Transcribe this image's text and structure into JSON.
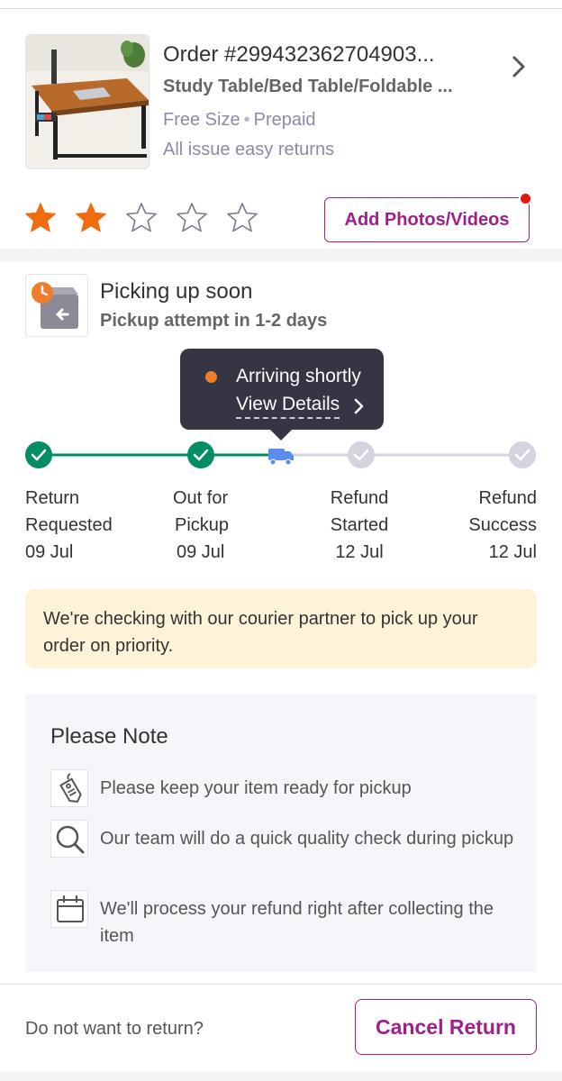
{
  "order": {
    "title": "Order #299432362704903...",
    "product_name": "Study Table/Bed Table/Foldable ...",
    "size": "Free Size",
    "payment": "Prepaid",
    "returns_note": "All issue easy returns",
    "rating": {
      "value": 2,
      "max": 5
    },
    "add_photos_label": "Add Photos/Videos"
  },
  "status": {
    "title": "Picking up soon",
    "subtitle": "Pickup attempt in 1-2 days",
    "tooltip_text": "Arriving shortly",
    "tooltip_link": "View Details",
    "steps": [
      {
        "line1": "Return",
        "line2": "Requested",
        "date": "09 Jul",
        "state": "done"
      },
      {
        "line1": "Out for",
        "line2": "Pickup",
        "date": "09 Jul",
        "state": "done"
      },
      {
        "line1": "Refund",
        "line2": "Started",
        "date": "12 Jul",
        "state": "pending"
      },
      {
        "line1": "Refund",
        "line2": "Success",
        "date": "12 Jul",
        "state": "pending"
      }
    ]
  },
  "info_message": "We're checking with our courier partner to pick up your order on priority.",
  "note": {
    "title": "Please Note",
    "items": [
      {
        "icon": "tag-icon",
        "text": "Please keep your item ready for pickup"
      },
      {
        "icon": "magnifier-icon",
        "text": "Our team will do a quick quality check during pickup"
      },
      {
        "icon": "calendar-icon",
        "text": "We'll process your refund right after collecting the item"
      }
    ]
  },
  "footer": {
    "question": "Do not want to return?",
    "cancel_label": "Cancel Return"
  },
  "colors": {
    "brand": "#9f2089",
    "success": "#038d63",
    "star": "#f06c10",
    "truck": "#5b8def",
    "pending": "#d4d4de",
    "info_bg": "#fdf3d8",
    "tooltip_bg": "#353543"
  }
}
